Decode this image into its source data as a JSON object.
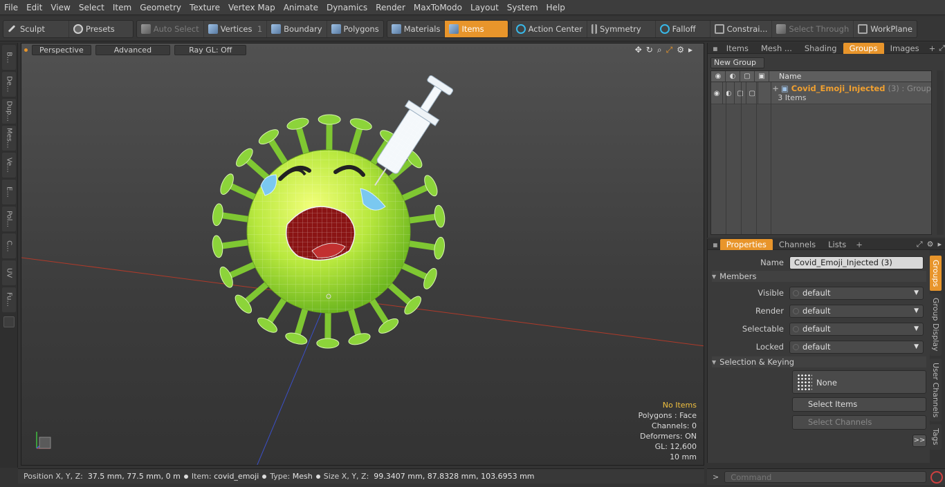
{
  "menu": [
    "File",
    "Edit",
    "View",
    "Select",
    "Item",
    "Geometry",
    "Texture",
    "Vertex Map",
    "Animate",
    "Dynamics",
    "Render",
    "MaxToModo",
    "Layout",
    "System",
    "Help"
  ],
  "toolbar": {
    "sculpt": "Sculpt",
    "presets": "Presets",
    "auto_select": "Auto Select",
    "vertices": "Vertices",
    "vertices_count": "1",
    "boundary": "Boundary",
    "polygons": "Polygons",
    "materials": "Materials",
    "items": "Items",
    "action_center": "Action Center",
    "symmetry": "Symmetry",
    "falloff": "Falloff",
    "constraints": "Constrai...",
    "select_through": "Select Through",
    "workplane": "WorkPlane"
  },
  "left_tabs": [
    "B...",
    "De...",
    "Dup...",
    "Mes...",
    "Ve...",
    "E...",
    "Pol...",
    "C...",
    "UV",
    "Fu..."
  ],
  "viewport": {
    "perspective": "Perspective",
    "advanced": "Advanced",
    "raygl": "Ray GL: Off",
    "stats": {
      "items": "No Items",
      "polygons": "Polygons : Face",
      "channels": "Channels: 0",
      "deformers": "Deformers: ON",
      "gl": "GL: 12,600",
      "scale": "10 mm"
    }
  },
  "status": {
    "position_label": "Position X, Y, Z:",
    "position": "37.5 mm, 77.5 mm, 0 m",
    "item_label": "Item:",
    "item": "covid_emoji",
    "type_label": "Type:",
    "type": "Mesh",
    "size_label": "Size X, Y, Z:",
    "size": "99.3407 mm, 87.8328 mm, 103.6953 mm"
  },
  "top_panel": {
    "tabs": [
      "Items",
      "Mesh ...",
      "Shading",
      "Groups",
      "Images"
    ],
    "active_tab": "Groups",
    "new_group": "New Group",
    "name_header": "Name",
    "group": {
      "name": "Covid_Emoji_Injected",
      "suffix": "(3) : Group",
      "count": "3 Items"
    }
  },
  "properties": {
    "tabs": [
      "Properties",
      "Channels",
      "Lists"
    ],
    "name_label": "Name",
    "name_value": "Covid_Emoji_Injected (3)",
    "members": "Members",
    "visible_label": "Visible",
    "visible": "default",
    "render_label": "Render",
    "render": "default",
    "selectable_label": "Selectable",
    "selectable": "default",
    "locked_label": "Locked",
    "locked": "default",
    "selection_keying": "Selection & Keying",
    "none": "None",
    "select_items": "Select Items",
    "select_channels": "Select Channels",
    "more": ">>",
    "side_tabs": [
      "Groups",
      "Group Display",
      "User Channels",
      "Tags"
    ]
  },
  "command": {
    "placeholder": "Command",
    "arrow": ">"
  },
  "colors": {
    "accent": "#e8952b",
    "virus": "#8cd43a",
    "selection": "#f0a030"
  }
}
